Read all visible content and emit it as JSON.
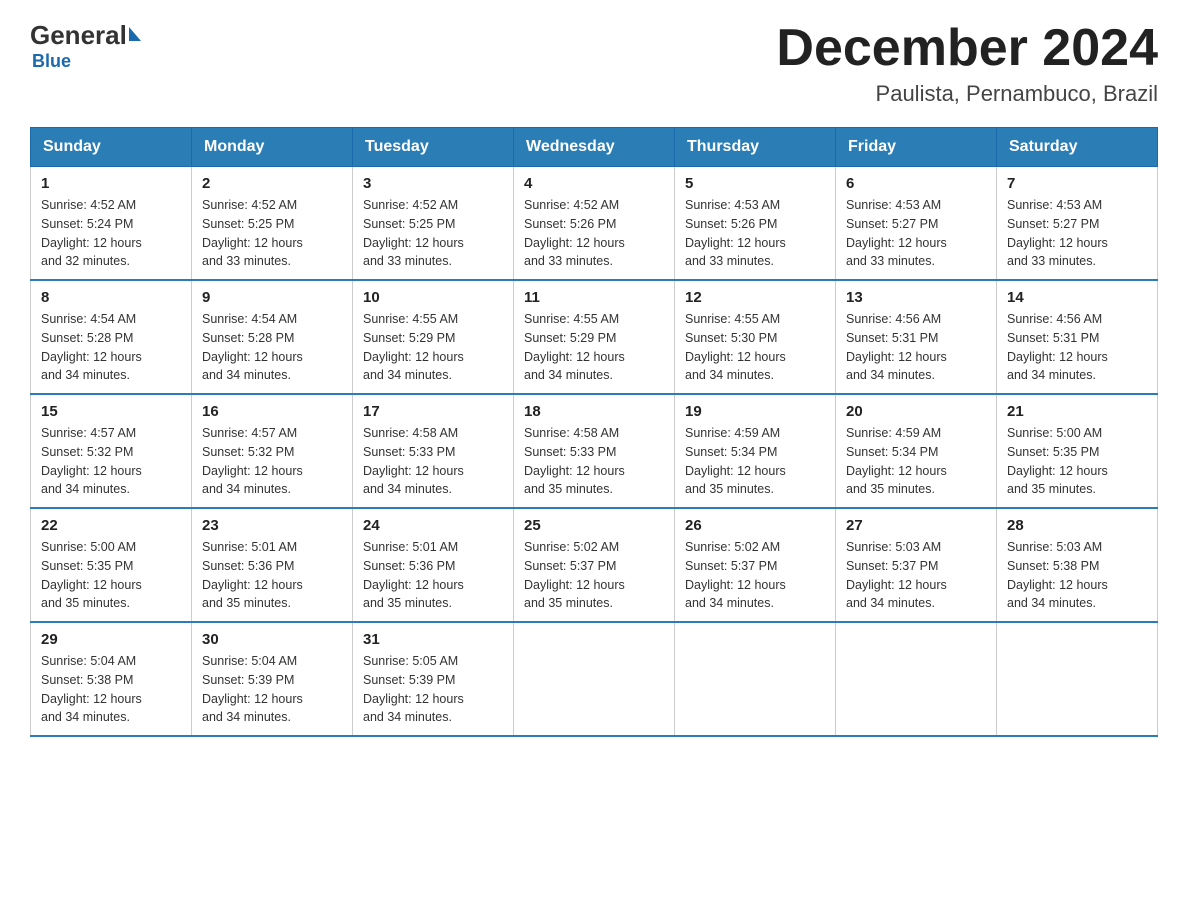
{
  "logo": {
    "general": "General",
    "blue": "Blue",
    "subtitle": "Blue"
  },
  "header": {
    "month_title": "December 2024",
    "location": "Paulista, Pernambuco, Brazil"
  },
  "days_of_week": [
    "Sunday",
    "Monday",
    "Tuesday",
    "Wednesday",
    "Thursday",
    "Friday",
    "Saturday"
  ],
  "weeks": [
    [
      {
        "day": "1",
        "sunrise": "4:52 AM",
        "sunset": "5:24 PM",
        "daylight": "12 hours and 32 minutes."
      },
      {
        "day": "2",
        "sunrise": "4:52 AM",
        "sunset": "5:25 PM",
        "daylight": "12 hours and 33 minutes."
      },
      {
        "day": "3",
        "sunrise": "4:52 AM",
        "sunset": "5:25 PM",
        "daylight": "12 hours and 33 minutes."
      },
      {
        "day": "4",
        "sunrise": "4:52 AM",
        "sunset": "5:26 PM",
        "daylight": "12 hours and 33 minutes."
      },
      {
        "day": "5",
        "sunrise": "4:53 AM",
        "sunset": "5:26 PM",
        "daylight": "12 hours and 33 minutes."
      },
      {
        "day": "6",
        "sunrise": "4:53 AM",
        "sunset": "5:27 PM",
        "daylight": "12 hours and 33 minutes."
      },
      {
        "day": "7",
        "sunrise": "4:53 AM",
        "sunset": "5:27 PM",
        "daylight": "12 hours and 33 minutes."
      }
    ],
    [
      {
        "day": "8",
        "sunrise": "4:54 AM",
        "sunset": "5:28 PM",
        "daylight": "12 hours and 34 minutes."
      },
      {
        "day": "9",
        "sunrise": "4:54 AM",
        "sunset": "5:28 PM",
        "daylight": "12 hours and 34 minutes."
      },
      {
        "day": "10",
        "sunrise": "4:55 AM",
        "sunset": "5:29 PM",
        "daylight": "12 hours and 34 minutes."
      },
      {
        "day": "11",
        "sunrise": "4:55 AM",
        "sunset": "5:29 PM",
        "daylight": "12 hours and 34 minutes."
      },
      {
        "day": "12",
        "sunrise": "4:55 AM",
        "sunset": "5:30 PM",
        "daylight": "12 hours and 34 minutes."
      },
      {
        "day": "13",
        "sunrise": "4:56 AM",
        "sunset": "5:31 PM",
        "daylight": "12 hours and 34 minutes."
      },
      {
        "day": "14",
        "sunrise": "4:56 AM",
        "sunset": "5:31 PM",
        "daylight": "12 hours and 34 minutes."
      }
    ],
    [
      {
        "day": "15",
        "sunrise": "4:57 AM",
        "sunset": "5:32 PM",
        "daylight": "12 hours and 34 minutes."
      },
      {
        "day": "16",
        "sunrise": "4:57 AM",
        "sunset": "5:32 PM",
        "daylight": "12 hours and 34 minutes."
      },
      {
        "day": "17",
        "sunrise": "4:58 AM",
        "sunset": "5:33 PM",
        "daylight": "12 hours and 34 minutes."
      },
      {
        "day": "18",
        "sunrise": "4:58 AM",
        "sunset": "5:33 PM",
        "daylight": "12 hours and 35 minutes."
      },
      {
        "day": "19",
        "sunrise": "4:59 AM",
        "sunset": "5:34 PM",
        "daylight": "12 hours and 35 minutes."
      },
      {
        "day": "20",
        "sunrise": "4:59 AM",
        "sunset": "5:34 PM",
        "daylight": "12 hours and 35 minutes."
      },
      {
        "day": "21",
        "sunrise": "5:00 AM",
        "sunset": "5:35 PM",
        "daylight": "12 hours and 35 minutes."
      }
    ],
    [
      {
        "day": "22",
        "sunrise": "5:00 AM",
        "sunset": "5:35 PM",
        "daylight": "12 hours and 35 minutes."
      },
      {
        "day": "23",
        "sunrise": "5:01 AM",
        "sunset": "5:36 PM",
        "daylight": "12 hours and 35 minutes."
      },
      {
        "day": "24",
        "sunrise": "5:01 AM",
        "sunset": "5:36 PM",
        "daylight": "12 hours and 35 minutes."
      },
      {
        "day": "25",
        "sunrise": "5:02 AM",
        "sunset": "5:37 PM",
        "daylight": "12 hours and 35 minutes."
      },
      {
        "day": "26",
        "sunrise": "5:02 AM",
        "sunset": "5:37 PM",
        "daylight": "12 hours and 34 minutes."
      },
      {
        "day": "27",
        "sunrise": "5:03 AM",
        "sunset": "5:37 PM",
        "daylight": "12 hours and 34 minutes."
      },
      {
        "day": "28",
        "sunrise": "5:03 AM",
        "sunset": "5:38 PM",
        "daylight": "12 hours and 34 minutes."
      }
    ],
    [
      {
        "day": "29",
        "sunrise": "5:04 AM",
        "sunset": "5:38 PM",
        "daylight": "12 hours and 34 minutes."
      },
      {
        "day": "30",
        "sunrise": "5:04 AM",
        "sunset": "5:39 PM",
        "daylight": "12 hours and 34 minutes."
      },
      {
        "day": "31",
        "sunrise": "5:05 AM",
        "sunset": "5:39 PM",
        "daylight": "12 hours and 34 minutes."
      },
      null,
      null,
      null,
      null
    ]
  ],
  "labels": {
    "sunrise": "Sunrise:",
    "sunset": "Sunset:",
    "daylight": "Daylight:"
  }
}
